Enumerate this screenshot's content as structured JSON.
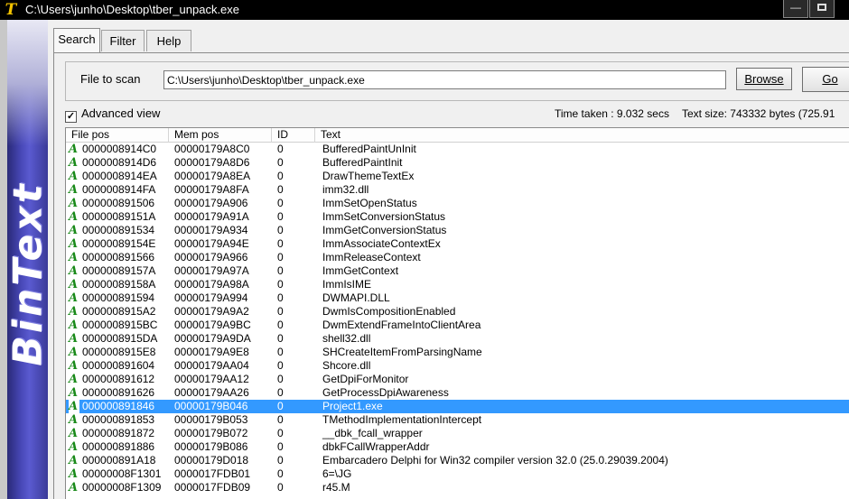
{
  "window": {
    "title": "C:\\Users\\junho\\Desktop\\tber_unpack.exe",
    "app_icon": "T",
    "brand": "BinText"
  },
  "tabs": [
    {
      "label": "Search"
    },
    {
      "label": "Filter"
    },
    {
      "label": "Help"
    }
  ],
  "scan": {
    "label": "File to scan",
    "value": "C:\\Users\\junho\\Desktop\\tber_unpack.exe",
    "browse": "Browse",
    "go": "Go"
  },
  "options": {
    "advanced_view_label": "Advanced view",
    "advanced_view_checked": true
  },
  "stats": {
    "time_taken": "Time taken : 9.032 secs",
    "text_size": "Text size: 743332 bytes (725.91"
  },
  "columns": {
    "file_pos": "File pos",
    "mem_pos": "Mem pos",
    "id": "ID",
    "text": "Text"
  },
  "rows": [
    {
      "type": "A",
      "file": "0000008914C0",
      "mem": "00000179A8C0",
      "id": "0",
      "text": "BufferedPaintUnInit"
    },
    {
      "type": "A",
      "file": "0000008914D6",
      "mem": "00000179A8D6",
      "id": "0",
      "text": "BufferedPaintInit"
    },
    {
      "type": "A",
      "file": "0000008914EA",
      "mem": "00000179A8EA",
      "id": "0",
      "text": "DrawThemeTextEx"
    },
    {
      "type": "A",
      "file": "0000008914FA",
      "mem": "00000179A8FA",
      "id": "0",
      "text": "imm32.dll"
    },
    {
      "type": "A",
      "file": "000000891506",
      "mem": "00000179A906",
      "id": "0",
      "text": "ImmSetOpenStatus"
    },
    {
      "type": "A",
      "file": "00000089151A",
      "mem": "00000179A91A",
      "id": "0",
      "text": "ImmSetConversionStatus"
    },
    {
      "type": "A",
      "file": "000000891534",
      "mem": "00000179A934",
      "id": "0",
      "text": "ImmGetConversionStatus"
    },
    {
      "type": "A",
      "file": "00000089154E",
      "mem": "00000179A94E",
      "id": "0",
      "text": "ImmAssociateContextEx"
    },
    {
      "type": "A",
      "file": "000000891566",
      "mem": "00000179A966",
      "id": "0",
      "text": "ImmReleaseContext"
    },
    {
      "type": "A",
      "file": "00000089157A",
      "mem": "00000179A97A",
      "id": "0",
      "text": "ImmGetContext"
    },
    {
      "type": "A",
      "file": "00000089158A",
      "mem": "00000179A98A",
      "id": "0",
      "text": "ImmIsIME"
    },
    {
      "type": "A",
      "file": "000000891594",
      "mem": "00000179A994",
      "id": "0",
      "text": "DWMAPI.DLL"
    },
    {
      "type": "A",
      "file": "0000008915A2",
      "mem": "00000179A9A2",
      "id": "0",
      "text": "DwmIsCompositionEnabled"
    },
    {
      "type": "A",
      "file": "0000008915BC",
      "mem": "00000179A9BC",
      "id": "0",
      "text": "DwmExtendFrameIntoClientArea"
    },
    {
      "type": "A",
      "file": "0000008915DA",
      "mem": "00000179A9DA",
      "id": "0",
      "text": "shell32.dll"
    },
    {
      "type": "A",
      "file": "0000008915E8",
      "mem": "00000179A9E8",
      "id": "0",
      "text": "SHCreateItemFromParsingName"
    },
    {
      "type": "A",
      "file": "000000891604",
      "mem": "00000179AA04",
      "id": "0",
      "text": "Shcore.dll"
    },
    {
      "type": "A",
      "file": "000000891612",
      "mem": "00000179AA12",
      "id": "0",
      "text": "GetDpiForMonitor"
    },
    {
      "type": "A",
      "file": "000000891626",
      "mem": "00000179AA26",
      "id": "0",
      "text": "GetProcessDpiAwareness"
    },
    {
      "type": "A",
      "file": "000000891846",
      "mem": "00000179B046",
      "id": "0",
      "text": "Project1.exe",
      "selected": true
    },
    {
      "type": "A",
      "file": "000000891853",
      "mem": "00000179B053",
      "id": "0",
      "text": "TMethodImplementationIntercept"
    },
    {
      "type": "A",
      "file": "000000891872",
      "mem": "00000179B072",
      "id": "0",
      "text": "__dbk_fcall_wrapper"
    },
    {
      "type": "A",
      "file": "000000891886",
      "mem": "00000179B086",
      "id": "0",
      "text": "dbkFCallWrapperAddr"
    },
    {
      "type": "A",
      "file": "000000891A18",
      "mem": "00000179D018",
      "id": "0",
      "text": "Embarcadero Delphi for Win32 compiler version 32.0 (25.0.29039.2004)"
    },
    {
      "type": "A",
      "file": "00000008F1301",
      "mem": "0000017FDB01",
      "id": "0",
      "text": "6=\\JG"
    },
    {
      "type": "A",
      "file": "00000008F1309",
      "mem": "0000017FDB09",
      "id": "0",
      "text": "r45.M"
    }
  ]
}
